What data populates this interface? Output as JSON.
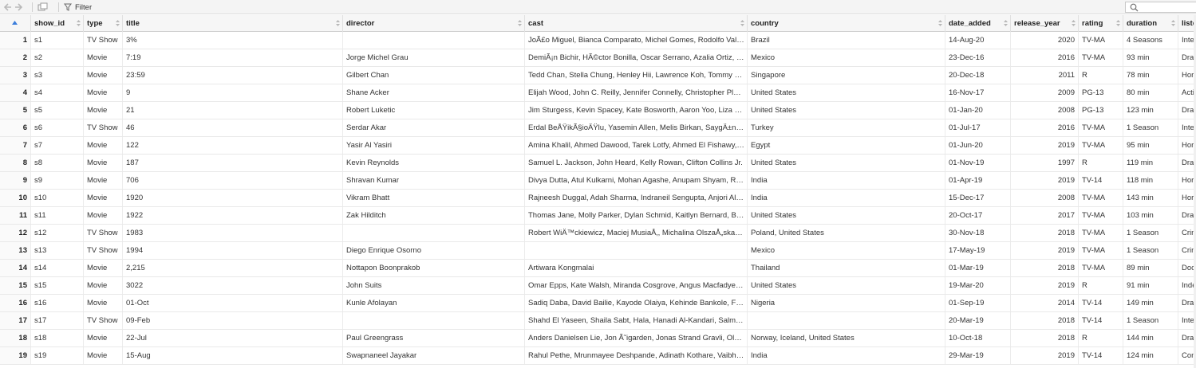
{
  "toolbar": {
    "filter_label": "Filter",
    "search_placeholder": ""
  },
  "columns": [
    "show_id",
    "type",
    "title",
    "director",
    "cast",
    "country",
    "date_added",
    "release_year",
    "rating",
    "duration",
    "liste"
  ],
  "rows": [
    {
      "n": "1",
      "c": [
        "s1",
        "TV Show",
        "3%",
        "",
        "JoÃ£o Miguel, Bianca Comparato, Michel Gomes, Rodolfo Valente, Vaneza Oliveira",
        "Brazil",
        "14-Aug-20",
        "2020",
        "TV-MA",
        "4 Seasons",
        "Inte"
      ]
    },
    {
      "n": "2",
      "c": [
        "s2",
        "Movie",
        "7:19",
        "Jorge Michel Grau",
        "DemiÃ¡n Bichir, HÃ©ctor Bonilla, Oscar Serrano, Azalia Ortiz, Octavio Michel",
        "Mexico",
        "23-Dec-16",
        "2016",
        "TV-MA",
        "93 min",
        "Dra"
      ]
    },
    {
      "n": "3",
      "c": [
        "s3",
        "Movie",
        "23:59",
        "Gilbert Chan",
        "Tedd Chan, Stella Chung, Henley Hii, Lawrence Koh, Tommy Kuan",
        "Singapore",
        "20-Dec-18",
        "2011",
        "R",
        "78 min",
        "Hor"
      ]
    },
    {
      "n": "4",
      "c": [
        "s4",
        "Movie",
        "9",
        "Shane Acker",
        "Elijah Wood, John C. Reilly, Jennifer Connelly, Christopher Plummer",
        "United States",
        "16-Nov-17",
        "2009",
        "PG-13",
        "80 min",
        "Acti"
      ]
    },
    {
      "n": "5",
      "c": [
        "s5",
        "Movie",
        "21",
        "Robert Luketic",
        "Jim Sturgess, Kevin Spacey, Kate Bosworth, Aaron Yoo, Liza Lapira",
        "United States",
        "01-Jan-20",
        "2008",
        "PG-13",
        "123 min",
        "Dra"
      ]
    },
    {
      "n": "6",
      "c": [
        "s6",
        "TV Show",
        "46",
        "Serdar Akar",
        "Erdal BeÅŸikÃ§ioÄŸlu, Yasemin Allen, Melis Birkan, SaygÄ±n Soysal",
        "Turkey",
        "01-Jul-17",
        "2016",
        "TV-MA",
        "1 Season",
        "Inte"
      ]
    },
    {
      "n": "7",
      "c": [
        "s7",
        "Movie",
        "122",
        "Yasir Al Yasiri",
        "Amina Khalil, Ahmed Dawood, Tarek Lotfy, Ahmed El Fishawy, Mahmoud",
        "Egypt",
        "01-Jun-20",
        "2019",
        "TV-MA",
        "95 min",
        "Hor"
      ]
    },
    {
      "n": "8",
      "c": [
        "s8",
        "Movie",
        "187",
        "Kevin Reynolds",
        "Samuel L. Jackson, John Heard, Kelly Rowan, Clifton Collins Jr.",
        "United States",
        "01-Nov-19",
        "1997",
        "R",
        "119 min",
        "Dra"
      ]
    },
    {
      "n": "9",
      "c": [
        "s9",
        "Movie",
        "706",
        "Shravan Kumar",
        "Divya Dutta, Atul Kulkarni, Mohan Agashe, Anupam Shyam, Raayo S. Bakhirta",
        "India",
        "01-Apr-19",
        "2019",
        "TV-14",
        "118 min",
        "Hor"
      ]
    },
    {
      "n": "10",
      "c": [
        "s10",
        "Movie",
        "1920",
        "Vikram Bhatt",
        "Rajneesh Duggal, Adah Sharma, Indraneil Sengupta, Anjori Alagh",
        "India",
        "15-Dec-17",
        "2008",
        "TV-MA",
        "143 min",
        "Hor"
      ]
    },
    {
      "n": "11",
      "c": [
        "s11",
        "Movie",
        "1922",
        "Zak Hilditch",
        "Thomas Jane, Molly Parker, Dylan Schmid, Kaitlyn Bernard, Bob Frazer",
        "United States",
        "20-Oct-17",
        "2017",
        "TV-MA",
        "103 min",
        "Dra"
      ]
    },
    {
      "n": "12",
      "c": [
        "s12",
        "TV Show",
        "1983",
        "",
        "Robert WiÄ™ckiewicz, Maciej MusiaÅ‚, Michalina OlszaÅ„ska, Andrzej Chyra",
        "Poland, United States",
        "30-Nov-18",
        "2018",
        "TV-MA",
        "1 Season",
        "Crin"
      ]
    },
    {
      "n": "13",
      "c": [
        "s13",
        "TV Show",
        "1994",
        "Diego Enrique Osorno",
        "",
        "Mexico",
        "17-May-19",
        "2019",
        "TV-MA",
        "1 Season",
        "Crin"
      ]
    },
    {
      "n": "14",
      "c": [
        "s14",
        "Movie",
        "2,215",
        "Nottapon Boonprakob",
        "Artiwara Kongmalai",
        "Thailand",
        "01-Mar-19",
        "2018",
        "TV-MA",
        "89 min",
        "Doc"
      ]
    },
    {
      "n": "15",
      "c": [
        "s15",
        "Movie",
        "3022",
        "John Suits",
        "Omar Epps, Kate Walsh, Miranda Cosgrove, Angus Macfadyen, Jorge Lendeborg",
        "United States",
        "19-Mar-20",
        "2019",
        "R",
        "91 min",
        "Inde"
      ]
    },
    {
      "n": "16",
      "c": [
        "s16",
        "Movie",
        "01-Oct",
        "Kunle Afolayan",
        "Sadiq Daba, David Bailie, Kayode Olaiya, Kehinde Bankole, Fabian Adeoye",
        "Nigeria",
        "01-Sep-19",
        "2014",
        "TV-14",
        "149 min",
        "Dra"
      ]
    },
    {
      "n": "17",
      "c": [
        "s17",
        "TV Show",
        "09-Feb",
        "",
        "Shahd El Yaseen, Shaila Sabt, Hala, Hanadi Al-Kandari, Salma Salem",
        "",
        "20-Mar-19",
        "2018",
        "TV-14",
        "1 Season",
        "Inte"
      ]
    },
    {
      "n": "18",
      "c": [
        "s18",
        "Movie",
        "22-Jul",
        "Paul Greengrass",
        "Anders Danielsen Lie, Jon Ã˜igarden, Jonas Strand Gravli, Ola G. Furuseth",
        "Norway, Iceland, United States",
        "10-Oct-18",
        "2018",
        "R",
        "144 min",
        "Dra"
      ]
    },
    {
      "n": "19",
      "c": [
        "s19",
        "Movie",
        "15-Aug",
        "Swapnaneel Jayakar",
        "Rahul Pethe, Mrunmayee Deshpande, Adinath Kothare, Vaibhav Mangle",
        "India",
        "29-Mar-19",
        "2019",
        "TV-14",
        "124 min",
        "Con"
      ]
    }
  ]
}
